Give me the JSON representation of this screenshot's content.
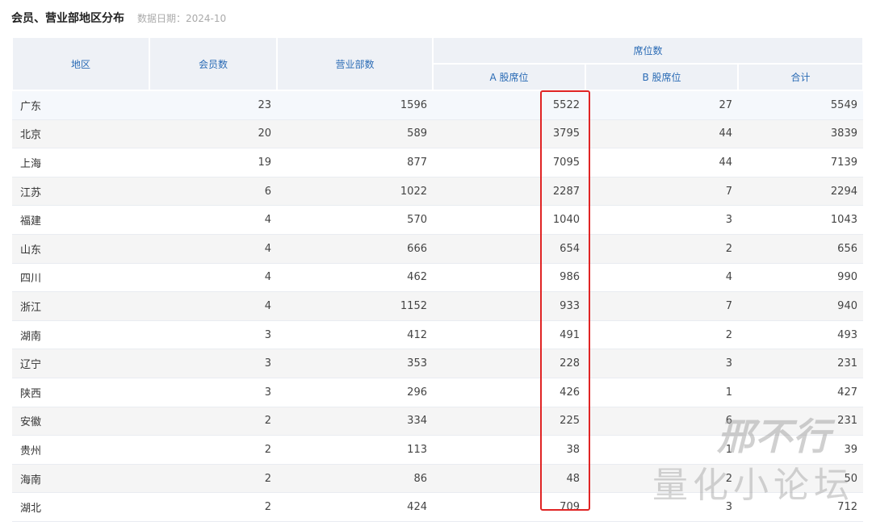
{
  "header": {
    "title": "会员、营业部地区分布",
    "date": "数据日期：2024-10"
  },
  "table": {
    "headers": {
      "region": "地区",
      "members": "会员数",
      "branches": "营业部数",
      "seats": "席位数",
      "a_seats": "A 股席位",
      "b_seats": "B 股席位",
      "total": "合计"
    },
    "rows": [
      {
        "region": "广东",
        "members": "23",
        "branches": "1596",
        "a_seats": "5522",
        "b_seats": "27",
        "total": "5549"
      },
      {
        "region": "北京",
        "members": "20",
        "branches": "589",
        "a_seats": "3795",
        "b_seats": "44",
        "total": "3839"
      },
      {
        "region": "上海",
        "members": "19",
        "branches": "877",
        "a_seats": "7095",
        "b_seats": "44",
        "total": "7139"
      },
      {
        "region": "江苏",
        "members": "6",
        "branches": "1022",
        "a_seats": "2287",
        "b_seats": "7",
        "total": "2294"
      },
      {
        "region": "福建",
        "members": "4",
        "branches": "570",
        "a_seats": "1040",
        "b_seats": "3",
        "total": "1043"
      },
      {
        "region": "山东",
        "members": "4",
        "branches": "666",
        "a_seats": "654",
        "b_seats": "2",
        "total": "656"
      },
      {
        "region": "四川",
        "members": "4",
        "branches": "462",
        "a_seats": "986",
        "b_seats": "4",
        "total": "990"
      },
      {
        "region": "浙江",
        "members": "4",
        "branches": "1152",
        "a_seats": "933",
        "b_seats": "7",
        "total": "940"
      },
      {
        "region": "湖南",
        "members": "3",
        "branches": "412",
        "a_seats": "491",
        "b_seats": "2",
        "total": "493"
      },
      {
        "region": "辽宁",
        "members": "3",
        "branches": "353",
        "a_seats": "228",
        "b_seats": "3",
        "total": "231"
      },
      {
        "region": "陕西",
        "members": "3",
        "branches": "296",
        "a_seats": "426",
        "b_seats": "1",
        "total": "427"
      },
      {
        "region": "安徽",
        "members": "2",
        "branches": "334",
        "a_seats": "225",
        "b_seats": "6",
        "total": "231"
      },
      {
        "region": "贵州",
        "members": "2",
        "branches": "113",
        "a_seats": "38",
        "b_seats": "1",
        "total": "39"
      },
      {
        "region": "海南",
        "members": "2",
        "branches": "86",
        "a_seats": "48",
        "b_seats": "2",
        "total": "50"
      },
      {
        "region": "湖北",
        "members": "2",
        "branches": "424",
        "a_seats": "709",
        "b_seats": "3",
        "total": "712"
      }
    ]
  },
  "watermark": {
    "line1": "邢不行",
    "line2": "量化小论坛"
  },
  "colors": {
    "header_bg": "#eef1f6",
    "header_text": "#2a6bb5",
    "highlight_border": "#e02424"
  }
}
